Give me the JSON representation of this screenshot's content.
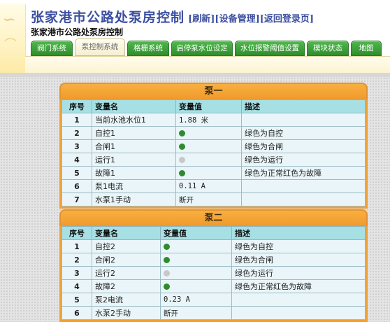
{
  "header": {
    "main_title": "张家港市公路处泵房控制",
    "links": [
      "[刷新]",
      "[设备管理]",
      "[返回登录页]"
    ],
    "sub_title": "张家港市公路处泵房控制"
  },
  "tabs": [
    {
      "label": "阀门系统",
      "active": false
    },
    {
      "label": "泵控制系统",
      "active": true
    },
    {
      "label": "格栅系统",
      "active": false
    },
    {
      "label": "启停泵水位设定",
      "active": false
    },
    {
      "label": "水位报警阈值设置",
      "active": false
    },
    {
      "label": "模块状态",
      "active": false
    },
    {
      "label": "地图",
      "active": false
    }
  ],
  "colors": {
    "indicator_on": "#2e8b2e",
    "indicator_off": "#c8c8c8",
    "panel_orange": "#f0a035",
    "header_cyan": "#a6e0e4"
  },
  "panels": [
    {
      "title": "泵一",
      "columns": [
        "序号",
        "变量名",
        "变量值",
        "描述"
      ],
      "rows": [
        {
          "no": "1",
          "name": "当前水池水位1",
          "value": "1.88 米",
          "indicator": "",
          "desc": ""
        },
        {
          "no": "2",
          "name": "自控1",
          "value": "",
          "indicator": "on",
          "desc": "绿色为自控"
        },
        {
          "no": "3",
          "name": "合闸1",
          "value": "",
          "indicator": "on",
          "desc": "绿色为合闸"
        },
        {
          "no": "4",
          "name": "运行1",
          "value": "",
          "indicator": "off",
          "desc": "绿色为运行"
        },
        {
          "no": "5",
          "name": "故障1",
          "value": "",
          "indicator": "on",
          "desc": "绿色为正常红色为故障"
        },
        {
          "no": "6",
          "name": "泵1电流",
          "value": "0.11 A",
          "indicator": "",
          "desc": ""
        },
        {
          "no": "7",
          "name": "水泵1手动",
          "value": "断开",
          "indicator": "",
          "desc": ""
        }
      ]
    },
    {
      "title": "泵二",
      "columns": [
        "序号",
        "变量名",
        "变量值",
        "描述"
      ],
      "rows": [
        {
          "no": "1",
          "name": "自控2",
          "value": "",
          "indicator": "on",
          "desc": "绿色为自控"
        },
        {
          "no": "2",
          "name": "合闸2",
          "value": "",
          "indicator": "on",
          "desc": "绿色为合闸"
        },
        {
          "no": "3",
          "name": "运行2",
          "value": "",
          "indicator": "off",
          "desc": "绿色为运行"
        },
        {
          "no": "4",
          "name": "故障2",
          "value": "",
          "indicator": "on",
          "desc": "绿色为正常红色为故障"
        },
        {
          "no": "5",
          "name": "泵2电流",
          "value": "0.23 A",
          "indicator": "",
          "desc": ""
        },
        {
          "no": "6",
          "name": "水泵2手动",
          "value": "断开",
          "indicator": "",
          "desc": ""
        }
      ]
    }
  ]
}
